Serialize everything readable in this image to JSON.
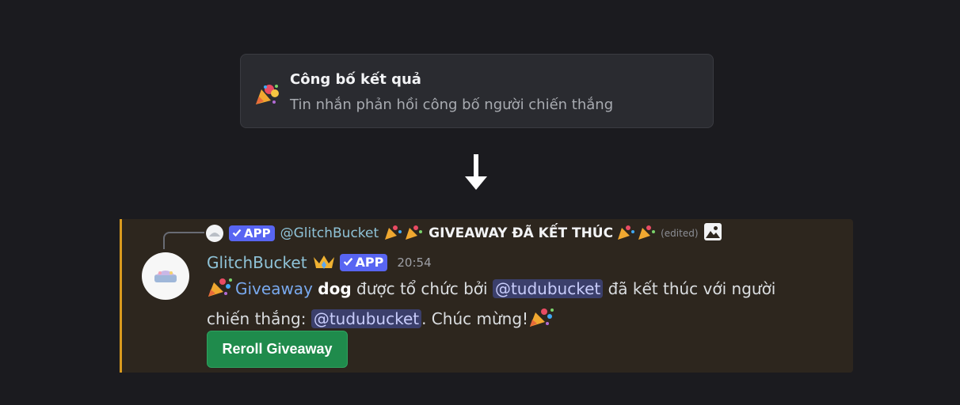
{
  "card": {
    "title": "Công bố kết quả",
    "subtitle": "Tin nhắn phản hồi công bố người chiến thắng",
    "icon": "party-popper-icon"
  },
  "arrow_icon": "arrow-down-icon",
  "message": {
    "reply": {
      "app_badge": "APP",
      "author": "@GlitchBucket",
      "text": "GIVEAWAY ĐÃ KẾT THÚC",
      "edited": "(edited)",
      "attachment_icon": "image-icon"
    },
    "author": "GlitchBucket",
    "app_badge": "APP",
    "timestamp": "20:54",
    "body": {
      "giveaway_link": "Giveaway",
      "prize": "dog",
      "text1": "được tổ chức bởi",
      "host_mention": "@tudubucket",
      "text2": "đã kết thúc với người chiến thắng:",
      "winner_mention": "@tudubucket",
      "text3": ". Chúc mừng!"
    },
    "button_label": "Reroll Giveaway"
  },
  "colors": {
    "accent_bar": "#d99a1e",
    "app_badge": "#5865f2",
    "button": "#1f8b4c",
    "mention_bg": "#3b3f6b"
  }
}
